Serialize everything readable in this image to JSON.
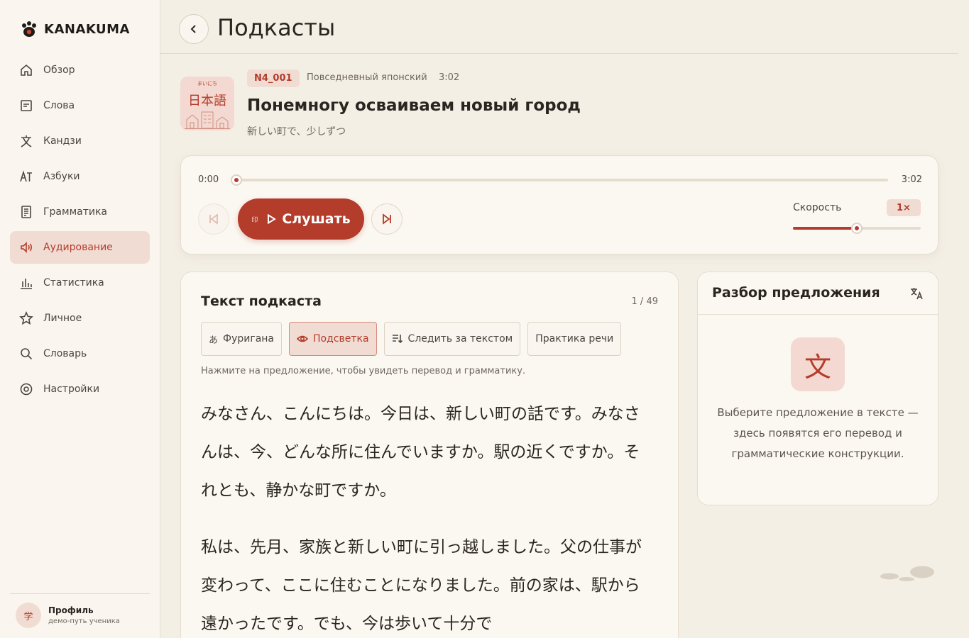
{
  "app": {
    "name": "KANAKUMA"
  },
  "sidebar": {
    "items": [
      {
        "label": "Обзор",
        "icon": "home-icon",
        "active": false
      },
      {
        "label": "Слова",
        "icon": "card-icon",
        "active": false
      },
      {
        "label": "Кандзи",
        "icon": "kanji-icon",
        "active": false
      },
      {
        "label": "Азбуки",
        "icon": "kana-icon",
        "active": false
      },
      {
        "label": "Грамматика",
        "icon": "document-icon",
        "active": false
      },
      {
        "label": "Аудирование",
        "icon": "speaker-icon",
        "active": true
      },
      {
        "label": "Статистика",
        "icon": "chart-icon",
        "active": false
      },
      {
        "label": "Личное",
        "icon": "star-icon",
        "active": false
      },
      {
        "label": "Словарь",
        "icon": "search-icon",
        "active": false
      },
      {
        "label": "Настройки",
        "icon": "gear-icon",
        "active": false
      }
    ],
    "profile": {
      "avatar": "学",
      "name": "Профиль",
      "subtitle": "демо-путь ученика"
    }
  },
  "header": {
    "title": "Подкасты"
  },
  "podcast": {
    "cover_small": "まいにち",
    "cover_main": "日本語",
    "level": "N4_001",
    "category": "Повседневный японский",
    "duration": "3:02",
    "title": "Понемногу осваиваем новый город",
    "subtitle": "新しい町で、少しずつ"
  },
  "player": {
    "current_time": "0:00",
    "total_time": "3:02",
    "progress": 0.0,
    "play_hint": "印",
    "play_label": "Слушать",
    "speed_label": "Скорость",
    "speed_value": "1×",
    "speed_level": 0.5
  },
  "text_panel": {
    "title": "Текст подкаста",
    "counter": "1 / 49",
    "chips": [
      {
        "prefix": "あ",
        "label": "Фуригана",
        "active": false,
        "icon": "hiragana-icon"
      },
      {
        "prefix": "",
        "label": "Подсветка",
        "active": true,
        "icon": "eye-icon"
      },
      {
        "prefix": "",
        "label": "Следить за текстом",
        "active": false,
        "icon": "follow-icon"
      },
      {
        "prefix": "",
        "label": "Практика речи",
        "active": false,
        "icon": ""
      }
    ],
    "hint": "Нажмите на предложение, чтобы увидеть перевод и грамматику.",
    "paragraphs": [
      "みなさん、こんにちは。今日は、新しい町の話です。みなさんは、今、どんな所に住んでいますか。駅の近くですか。それとも、静かな町ですか。",
      "私は、先月、家族と新しい町に引っ越しました。父の仕事が変わって、ここに住むことになりました。前の家は、駅から遠かったです。でも、今は歩いて十分で"
    ]
  },
  "analysis": {
    "title": "Разбор предложения",
    "kanji": "文",
    "description": "Выберите предложение в тексте — здесь появятся его перевод и грамматические конструкции."
  },
  "colors": {
    "accent": "#b33c2a",
    "accent_soft": "#f1dcd3",
    "background": "#f4efe5",
    "card": "#fbf8f2"
  }
}
